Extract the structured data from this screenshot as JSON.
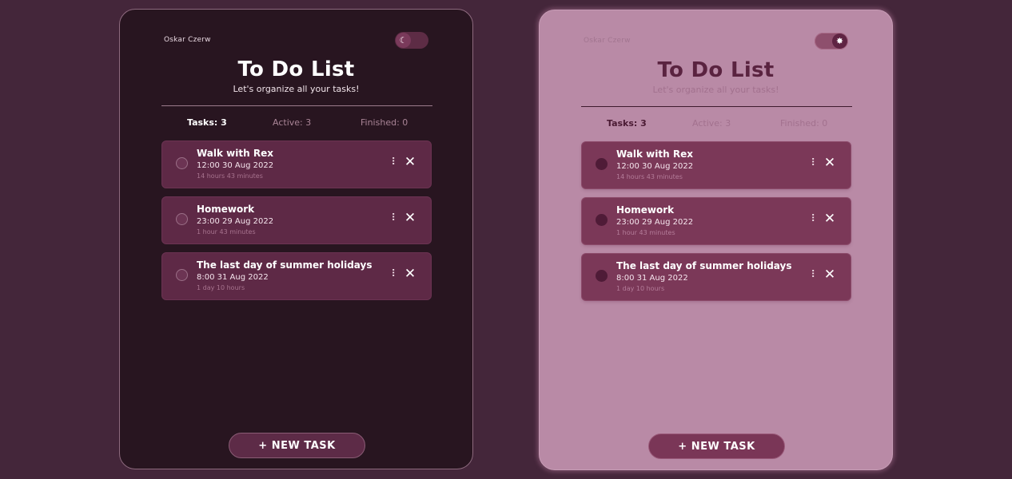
{
  "author": "Oskar Czerw",
  "title": "To Do List",
  "subtitle": "Let's organize all your tasks!",
  "stats": {
    "tasks_label": "Tasks: 3",
    "active_label": "Active: 3",
    "finished_label": "Finished: 0"
  },
  "tasks": [
    {
      "name": "Walk with Rex",
      "date": "12:00 30 Aug 2022",
      "remaining": "14 hours 43 minutes"
    },
    {
      "name": "Homework",
      "date": "23:00 29 Aug 2022",
      "remaining": "1 hour 43 minutes"
    },
    {
      "name": "The last day of summer holidays",
      "date": "8:00 31 Aug 2022",
      "remaining": "1 day 10 hours"
    }
  ],
  "new_task_label": "+ NEW TASK",
  "icons": {
    "dark_toggle": "moon-icon",
    "light_toggle": "sun-icon",
    "drag": "drag-handle-icon",
    "delete": "close-icon"
  },
  "colors": {
    "background": "#44263a",
    "dark_panel": "#281520",
    "light_panel": "#b98aa6",
    "task_dark": "#5e2946",
    "task_light": "#7b3858"
  }
}
